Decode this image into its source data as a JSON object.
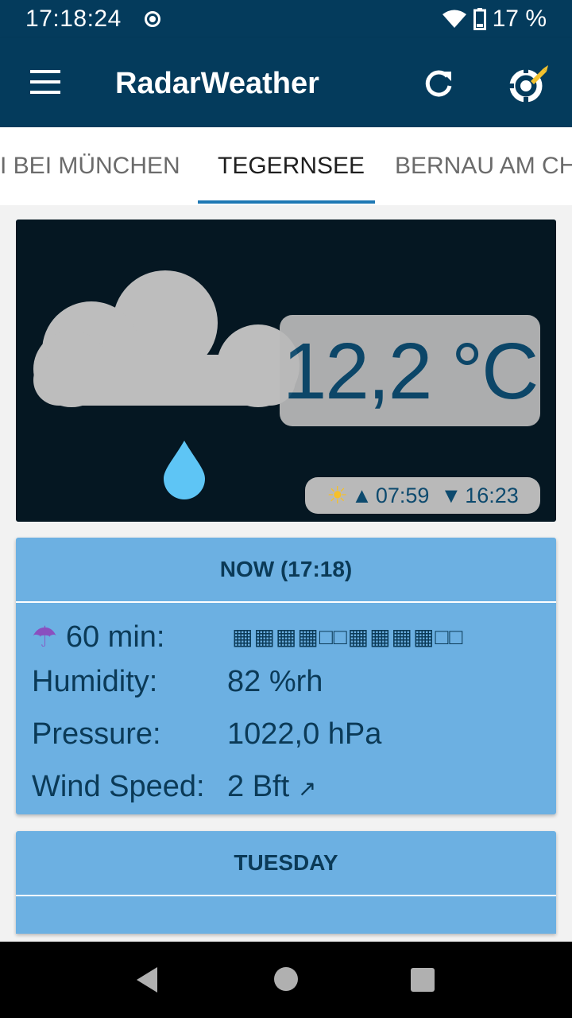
{
  "status_bar": {
    "time": "17:18:24",
    "battery_percent": "17 %"
  },
  "app_bar": {
    "title": "RadarWeather"
  },
  "tabs": [
    {
      "label": "I BEI MÜNCHEN"
    },
    {
      "label": "TEGERNSEE"
    },
    {
      "label": "BERNAU AM CH"
    }
  ],
  "hero": {
    "temperature": "12,2 °C",
    "condition_icon": "cloud-rain-icon",
    "sunrise": "07:59",
    "sunset": "16:23"
  },
  "now_card": {
    "title": "NOW (17:18)",
    "precip_label": "60 min:",
    "precip_forecast": "▦▦▦▦□□▦▦▦▦□□",
    "humidity_label": "Humidity:",
    "humidity_value": "82 %rh",
    "pressure_label": "Pressure:",
    "pressure_value": "1022,0  hPa",
    "wind_label": "Wind Speed:",
    "wind_value": "2 Bft",
    "wind_arrow": "↗"
  },
  "day_card": {
    "title": "TUESDAY"
  },
  "colors": {
    "primary": "#043b5c",
    "card": "#6cb0e2",
    "hero_bg": "#051722",
    "cloud": "#bdbdbd",
    "drop": "#5ec5f5"
  }
}
